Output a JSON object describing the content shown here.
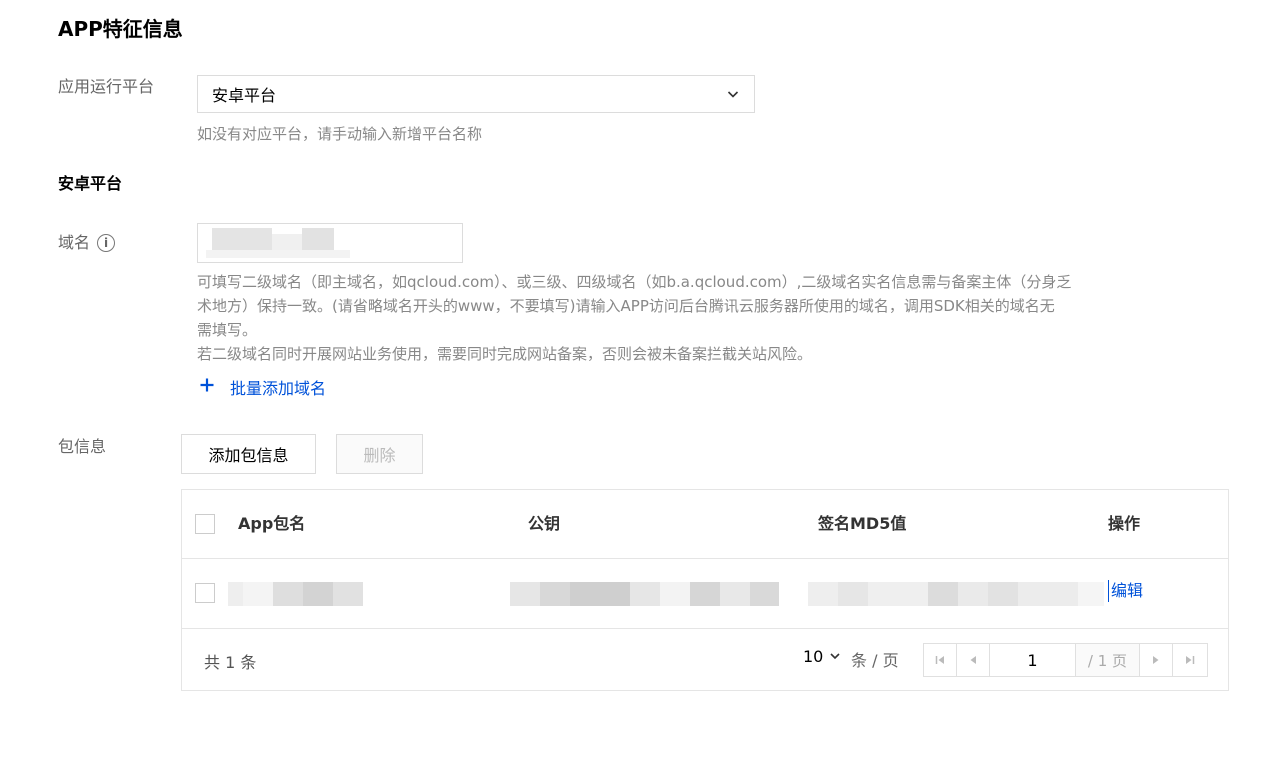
{
  "page": {
    "title": "APP特征信息"
  },
  "platform": {
    "label": "应用运行平台",
    "selected": "安卓平台",
    "hint": "如没有对应平台，请手动输入新增平台名称"
  },
  "section_title": "安卓平台",
  "domain": {
    "label": "域名",
    "help_lines": [
      "可填写二级域名（即主域名，如qcloud.com）、或三级、四级域名（如b.a.qcloud.com）,二级域名实名信息需与备案主体（分身乏",
      "术地方）保持一致。(请省略域名开头的www，不要填写)请输入APP访问后台腾讯云服务器所使用的域名，调用SDK相关的域名无",
      "需填写。",
      "若二级域名同时开展网站业务使用，需要同时完成网站备案，否则会被未备案拦截关站风险。"
    ],
    "batch_add": "批量添加域名"
  },
  "package": {
    "label": "包信息",
    "add_button": "添加包信息",
    "delete_button": "删除",
    "columns": [
      "App包名",
      "公钥",
      "签名MD5值",
      "操作"
    ],
    "row_action": "编辑"
  },
  "pagination": {
    "total": "共 1 条",
    "page_size": "10",
    "per_page": "条 / 页",
    "current_page": "1",
    "total_pages": "/ 1 页"
  },
  "colors": {
    "accent": "#0052d9",
    "border": "#dcdcdc",
    "muted": "#888888"
  }
}
